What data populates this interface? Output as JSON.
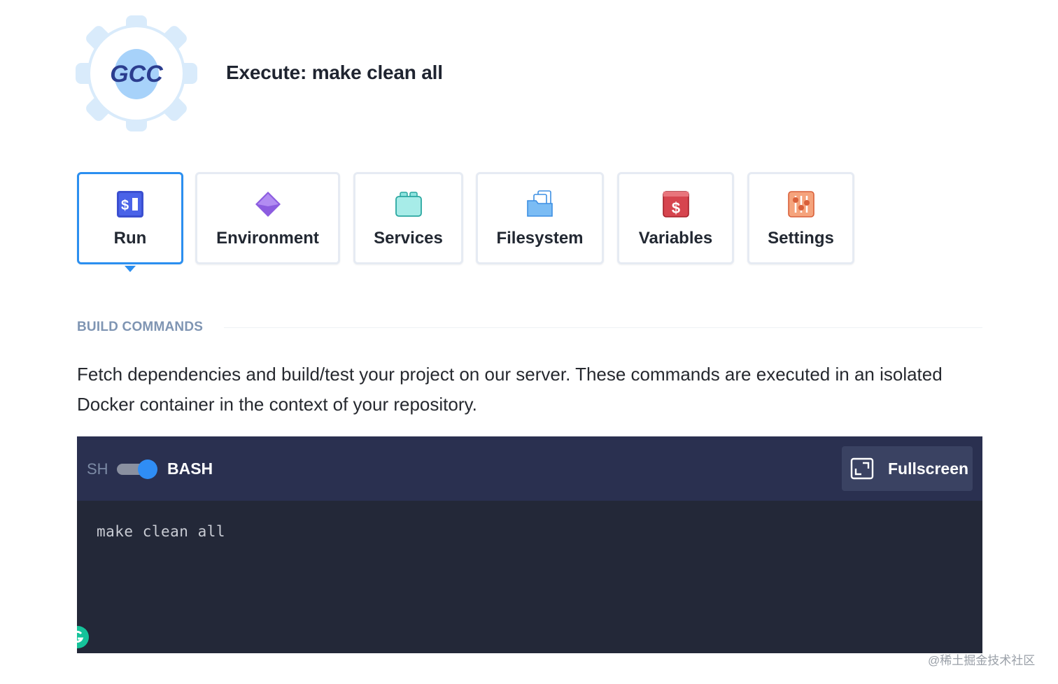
{
  "header": {
    "logo_text": "GCC",
    "title": "Execute: make clean all"
  },
  "tabs": [
    {
      "label": "Run",
      "icon": "terminal-icon",
      "active": true
    },
    {
      "label": "Environment",
      "icon": "diamond-icon",
      "active": false
    },
    {
      "label": "Services",
      "icon": "lego-block-icon",
      "active": false
    },
    {
      "label": "Filesystem",
      "icon": "folder-files-icon",
      "active": false
    },
    {
      "label": "Variables",
      "icon": "dollar-box-icon",
      "active": false
    },
    {
      "label": "Settings",
      "icon": "sliders-icon",
      "active": false
    }
  ],
  "section": {
    "title": "BUILD COMMANDS",
    "description": "Fetch dependencies and build/test your project on our server. These commands are executed in an isolated Docker container in the context of your repository."
  },
  "editor": {
    "shell_off_label": "SH",
    "shell_on_label": "BASH",
    "shell_toggle_on": true,
    "fullscreen_label": "Fullscreen",
    "code": "make clean all"
  },
  "watermark": "@稀土掘金技术社区",
  "colors": {
    "accent": "#2b8ff0",
    "editor_bg": "#232838",
    "editor_bar": "#2a3050",
    "section_title": "#7f95b3"
  }
}
